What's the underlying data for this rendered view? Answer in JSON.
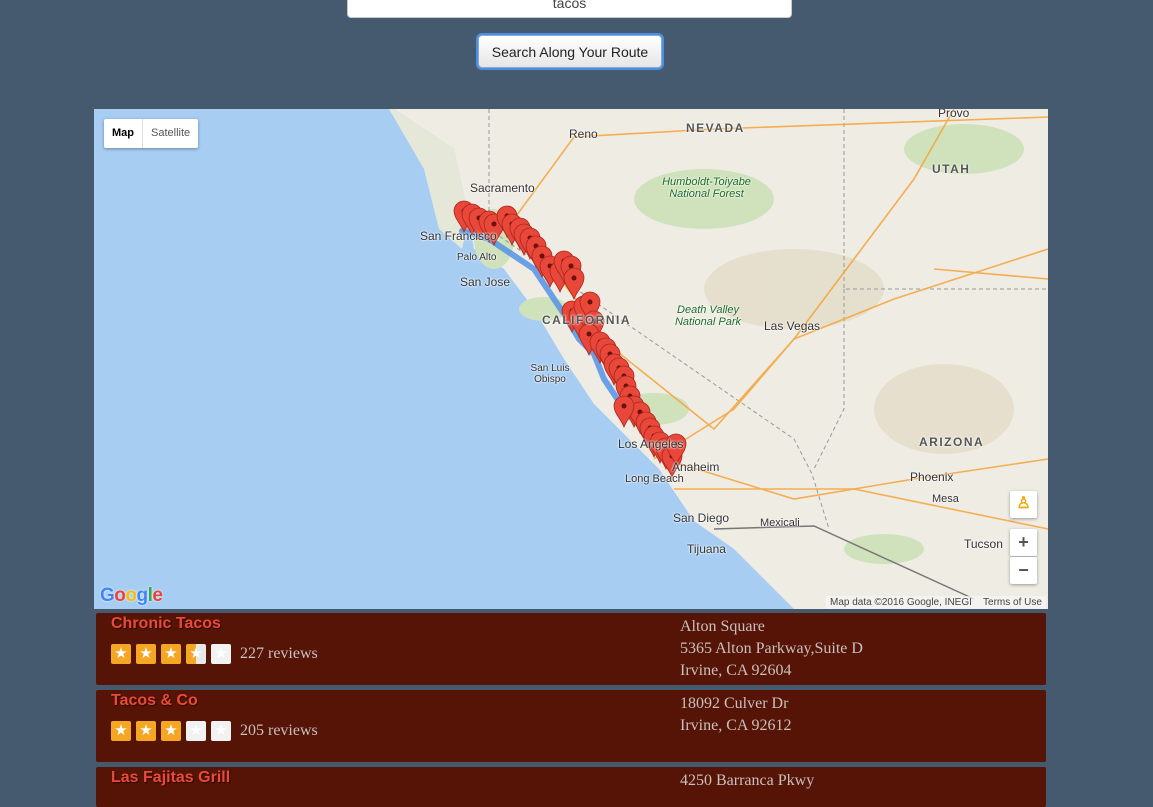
{
  "search": {
    "value": "tacos"
  },
  "search_button": {
    "label": "Search Along Your Route"
  },
  "map": {
    "type_controls": {
      "map": "Map",
      "satellite": "Satellite",
      "active": "Map"
    },
    "zoom_in": "+",
    "zoom_out": "−",
    "logo": [
      "G",
      "o",
      "o",
      "g",
      "l",
      "e"
    ],
    "logo_colors": [
      "#4285f4",
      "#ea4335",
      "#fbbc05",
      "#4285f4",
      "#34a853",
      "#ea4335"
    ],
    "attribution": "Map data ©2016 Google, INEGI",
    "terms": "Terms of Use",
    "labels": {
      "nevada": "NEVADA",
      "utah": "UTAH",
      "arizona": "ARIZONA",
      "california": "CALIFORNIA",
      "reno": "Reno",
      "provo": "Provo",
      "sacramento": "Sacramento",
      "san_francisco": "San Francisco",
      "palo_alto": "Palo Alto",
      "san_jose": "San Jose",
      "san_luis_obispo": "San Luis Obispo",
      "las_vegas": "Las Vegas",
      "los_angeles": "Los Angeles",
      "anaheim": "Anaheim",
      "long_beach": "Long Beach",
      "san_diego": "San Diego",
      "tijuana": "Tijuana",
      "mexicali": "Mexicali",
      "phoenix": "Phoenix",
      "mesa": "Mesa",
      "tucson": "Tucson",
      "humboldt": "Humboldt-Toiyabe National Forest",
      "death_valley": "Death Valley National Park"
    },
    "colors": {
      "water": "#a7cdf3",
      "land": "#efece4",
      "route": "#5393e6",
      "marker": "#e8473a",
      "interstate": "#f5a742"
    }
  },
  "results": [
    {
      "name": "Chronic Tacos",
      "rating": 3.5,
      "reviews": "227 reviews",
      "address": [
        "Alton Square",
        "5365 Alton Parkway,Suite D",
        "Irvine, CA 92604"
      ]
    },
    {
      "name": "Tacos & Co",
      "rating": 3,
      "reviews": "205 reviews",
      "address": [
        "18092 Culver Dr",
        "Irvine, CA 92612"
      ]
    },
    {
      "name": "Las Fajitas Grill",
      "rating": 0,
      "reviews": "",
      "address": [
        "4250 Barranca Pkwy"
      ]
    }
  ]
}
